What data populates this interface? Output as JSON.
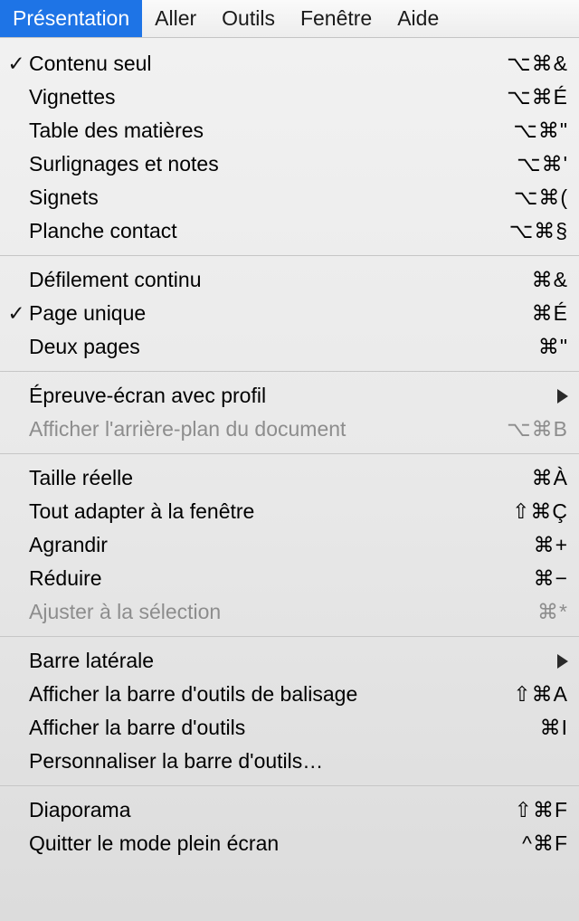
{
  "menubar": {
    "items": [
      {
        "label": "Présentation",
        "selected": true
      },
      {
        "label": "Aller"
      },
      {
        "label": "Outils"
      },
      {
        "label": "Fenêtre"
      },
      {
        "label": "Aide"
      }
    ]
  },
  "menu": {
    "groups": [
      {
        "items": [
          {
            "label": "Contenu seul",
            "shortcut": "⌥⌘&",
            "checked": true
          },
          {
            "label": "Vignettes",
            "shortcut": "⌥⌘É"
          },
          {
            "label": "Table des matières",
            "shortcut": "⌥⌘\""
          },
          {
            "label": "Surlignages et notes",
            "shortcut": "⌥⌘'"
          },
          {
            "label": "Signets",
            "shortcut": "⌥⌘("
          },
          {
            "label": "Planche contact",
            "shortcut": "⌥⌘§"
          }
        ]
      },
      {
        "items": [
          {
            "label": "Défilement continu",
            "shortcut": "⌘&"
          },
          {
            "label": "Page unique",
            "shortcut": "⌘É",
            "checked": true
          },
          {
            "label": "Deux pages",
            "shortcut": "⌘\""
          }
        ]
      },
      {
        "items": [
          {
            "label": "Épreuve-écran avec profil",
            "submenu": true
          },
          {
            "label": "Afficher l'arrière-plan du document",
            "shortcut": "⌥⌘B",
            "disabled": true
          }
        ]
      },
      {
        "items": [
          {
            "label": "Taille réelle",
            "shortcut": "⌘À"
          },
          {
            "label": "Tout adapter à la fenêtre",
            "shortcut": "⇧⌘Ç"
          },
          {
            "label": "Agrandir",
            "shortcut": "⌘+"
          },
          {
            "label": "Réduire",
            "shortcut": "⌘−"
          },
          {
            "label": "Ajuster à la sélection",
            "shortcut": "⌘*",
            "disabled": true
          }
        ]
      },
      {
        "items": [
          {
            "label": "Barre latérale",
            "submenu": true
          },
          {
            "label": "Afficher la barre d'outils de balisage",
            "shortcut": "⇧⌘A"
          },
          {
            "label": "Afficher la barre d'outils",
            "shortcut": "⌘I"
          },
          {
            "label": "Personnaliser la barre d'outils…"
          }
        ]
      },
      {
        "items": [
          {
            "label": "Diaporama",
            "shortcut": "⇧⌘F"
          },
          {
            "label": "Quitter le mode plein écran",
            "shortcut": "^⌘F"
          }
        ]
      }
    ]
  }
}
